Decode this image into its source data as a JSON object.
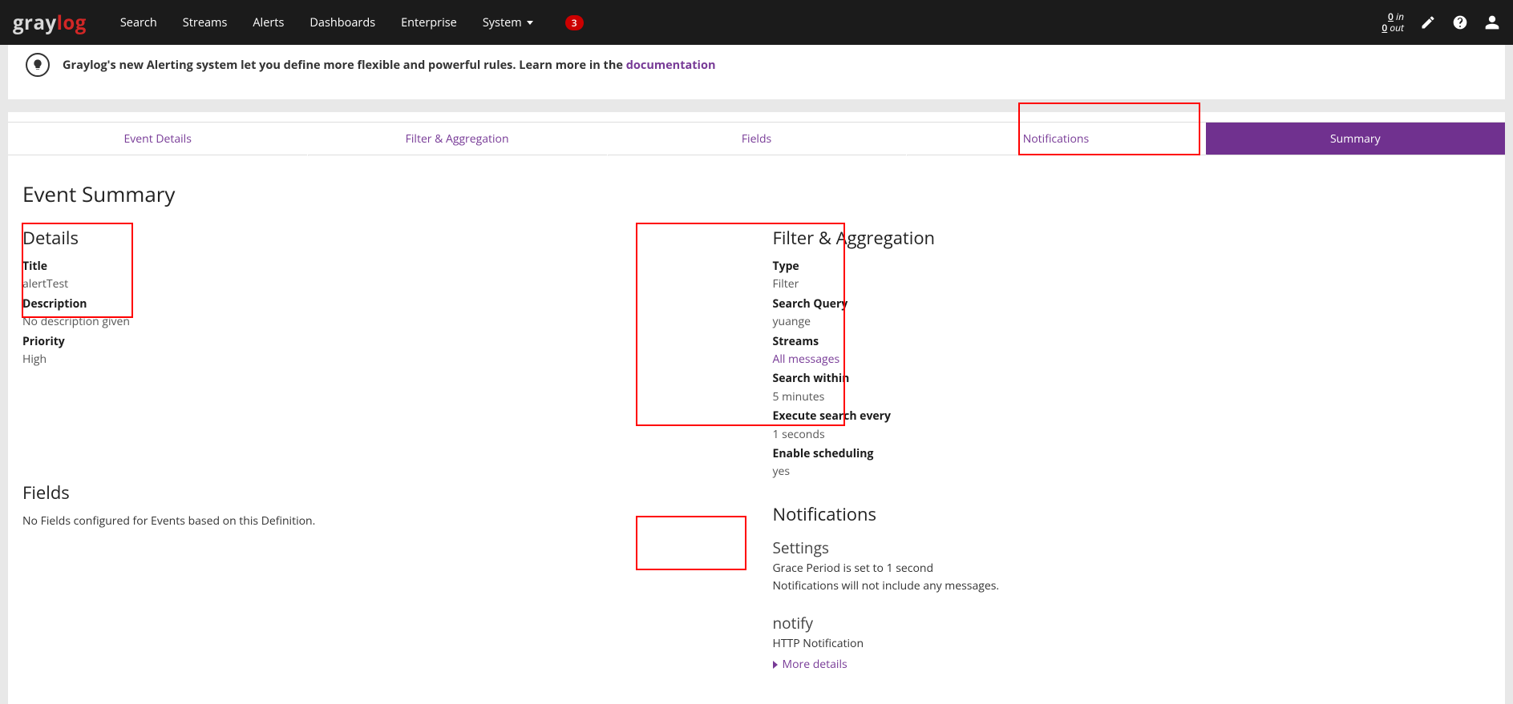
{
  "nav": {
    "brand_gray": "gray",
    "brand_red": "log",
    "links": [
      "Search",
      "Streams",
      "Alerts",
      "Dashboards",
      "Enterprise",
      "System"
    ],
    "badge": "3",
    "inout_top": "0",
    "inout_top_lbl": "in",
    "inout_bot": "0",
    "inout_bot_lbl": "out"
  },
  "banner": {
    "text_a": "Graylog's new Alerting system let you define more flexible and powerful rules. Learn more in the ",
    "link": "documentation"
  },
  "wizard": [
    "Event Details",
    "Filter & Aggregation",
    "Fields",
    "Notifications",
    "Summary"
  ],
  "page_title": "Event Summary",
  "details": {
    "heading": "Details",
    "title_lbl": "Title",
    "title_val": "alertTest",
    "desc_lbl": "Description",
    "desc_val": "No description given",
    "prio_lbl": "Priority",
    "prio_val": "High"
  },
  "filter": {
    "heading": "Filter & Aggregation",
    "type_lbl": "Type",
    "type_val": "Filter",
    "query_lbl": "Search Query",
    "query_val": "yuange",
    "streams_lbl": "Streams",
    "streams_val": "All messages",
    "within_lbl": "Search within",
    "within_val": "5 minutes",
    "exec_lbl": "Execute search every",
    "exec_val": "1 seconds",
    "sched_lbl": "Enable scheduling",
    "sched_val": "yes"
  },
  "fields": {
    "heading": "Fields",
    "empty": "No Fields configured for Events based on this Definition."
  },
  "notifications": {
    "heading": "Notifications",
    "settings_lbl": "Settings",
    "grace": "Grace Period is set to 1 second",
    "nomsg": "Notifications will not include any messages.",
    "notify_name": "notify",
    "notify_type": "HTTP Notification",
    "more": "More details"
  }
}
